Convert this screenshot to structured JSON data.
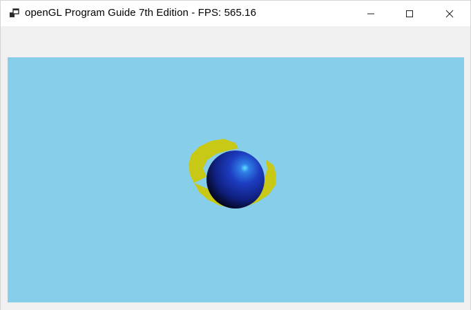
{
  "window": {
    "title": "openGL Program Guide 7th Edition - FPS: 565.16",
    "app_icon": "app-window-icon",
    "controls": {
      "minimize_icon": "minimize-icon",
      "maximize_icon": "maximize-icon",
      "close_icon": "close-icon"
    }
  },
  "scene": {
    "background_color": "#87ceeb",
    "sphere_color": "#1a2fa8",
    "sphere_highlight_color": "#4fd0ff",
    "ring_color": "#c8c817",
    "objects": [
      "sphere",
      "torus"
    ]
  }
}
